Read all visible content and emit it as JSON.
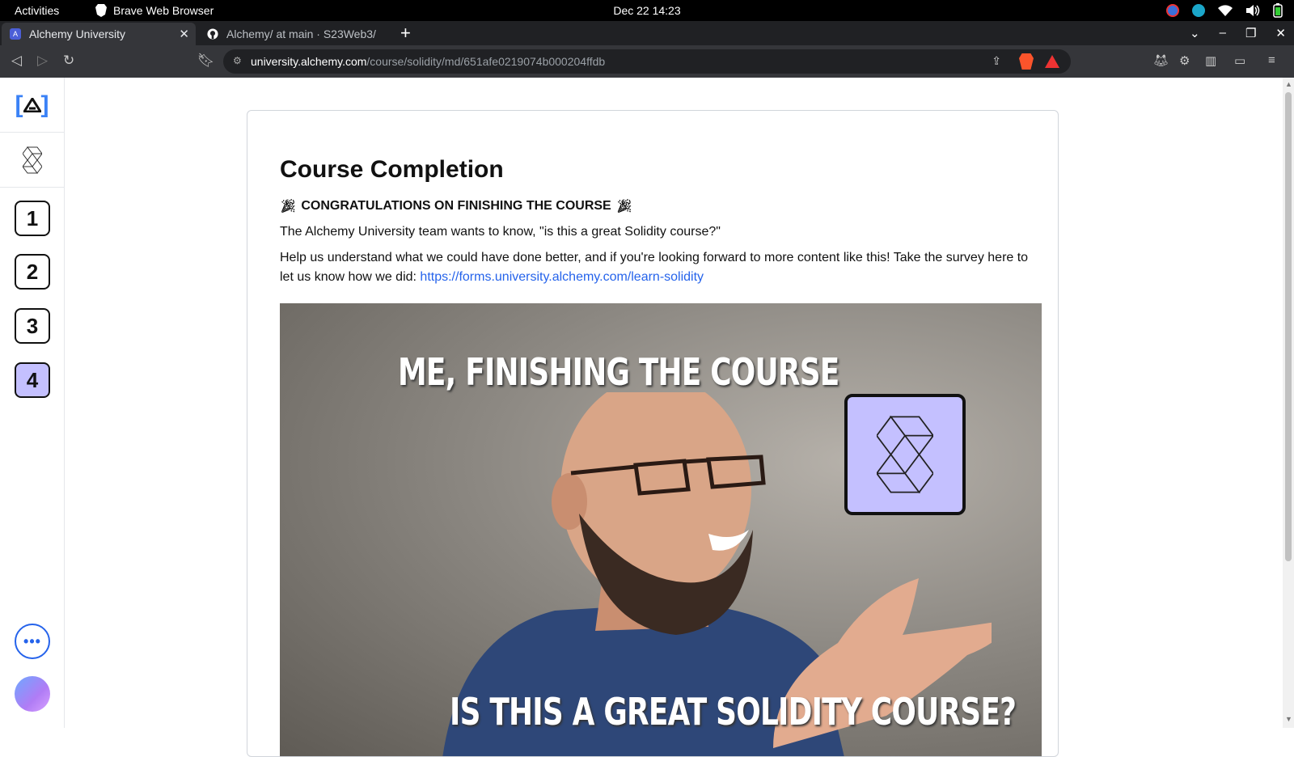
{
  "system": {
    "activities": "Activities",
    "app_name": "Brave Web Browser",
    "clock": "Dec 22  14:23"
  },
  "browser": {
    "tabs": [
      {
        "title": "Alchemy University",
        "active": true
      },
      {
        "title": "Alchemy/ at main · S23Web3/",
        "active": false
      }
    ],
    "url_host": "university.alchemy.com",
    "url_path": "/course/solidity/md/651afe0219074b000204ffdb",
    "brave_shield_count": "3"
  },
  "sidebar": {
    "lessons": [
      "1",
      "2",
      "3",
      "4"
    ],
    "current_lesson": "4",
    "more_label": "•••"
  },
  "content": {
    "title": "Course Completion",
    "congrats": "CONGRATULATIONS ON FINISHING THE COURSE",
    "question": "The Alchemy University team wants to know, \"is this a great Solidity course?\"",
    "help_text": "Help us understand what we could have done better, and if you're looking forward to more content like this! Take the survey here to let us know how we did: ",
    "survey_link": "https://forms.university.alchemy.com/learn-solidity",
    "meme_top": "ME, FINISHING THE COURSE",
    "meme_bottom": "IS THIS A GREAT SOLIDITY COURSE?"
  },
  "colors": {
    "accent": "#2563eb",
    "current_lesson_bg": "#c4c0ff"
  }
}
